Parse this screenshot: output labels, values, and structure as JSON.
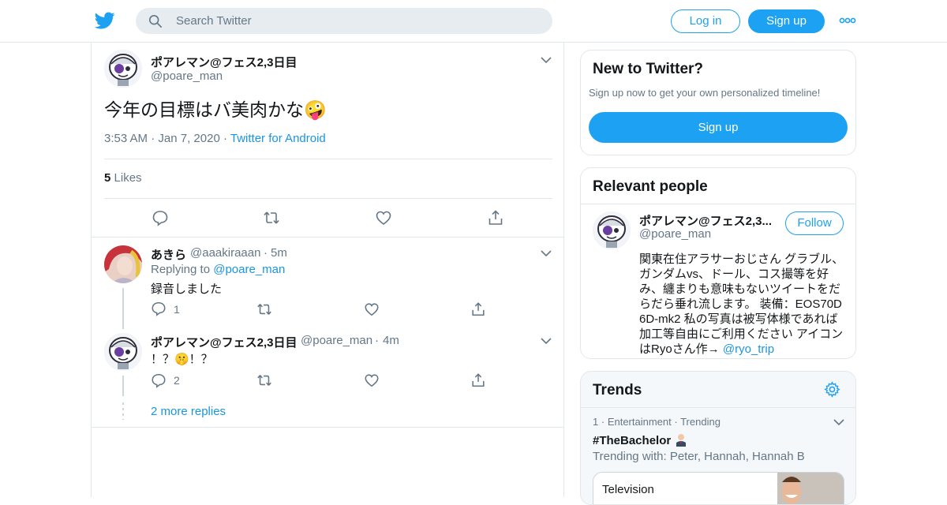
{
  "header": {
    "search_placeholder": "Search Twitter",
    "login_label": "Log in",
    "signup_label": "Sign up",
    "brand_color": "#1da1f2"
  },
  "main_tweet": {
    "name": "ポアレマン@フェス2,3日目",
    "handle": "@poare_man",
    "text": "今年の目標はバ美肉かな🤪",
    "time": "3:53 AM",
    "date": "Jan 7, 2020",
    "source": "Twitter for Android",
    "likes_count": "5",
    "likes_label": "Likes"
  },
  "replies": [
    {
      "name": "あきら",
      "handle": "@aaakiraaan",
      "age": "5m",
      "replying_label": "Replying to",
      "replying_handle": "@poare_man",
      "text": "録音しました",
      "reply_count": "1"
    },
    {
      "name": "ポアレマン@フェス2,3日目",
      "handle": "@poare_man",
      "age": "4m",
      "text": "！？🤫！？",
      "reply_count": "2"
    }
  ],
  "more_replies": "2 more replies",
  "new_to_twitter": {
    "title": "New to Twitter?",
    "subtitle": "Sign up now to get your own personalized timeline!",
    "button": "Sign up"
  },
  "relevant_people": {
    "title": "Relevant people",
    "name": "ポアレマン@フェス2,3...",
    "handle": "@poare_man",
    "follow_label": "Follow",
    "bio": "関東在住アラサーおじさん グラブル、ガンダムvs、ドール、コス撮等を好み、纏まりも意味もないツイートをだらだら垂れ流します。 装備：EOS70D 6D-mk2 私の写真は被写体様であれば加工等自由にご利用ください アイコンはRyoさん作→ ",
    "bio_link": "@ryo_trip"
  },
  "trends": {
    "title": "Trends",
    "item": {
      "rank": "1",
      "category": "Entertainment",
      "status": "Trending",
      "name": "#TheBachelor",
      "trending_with": "Trending with: Peter, Hannah, Hannah B",
      "card_label": "Television"
    }
  }
}
